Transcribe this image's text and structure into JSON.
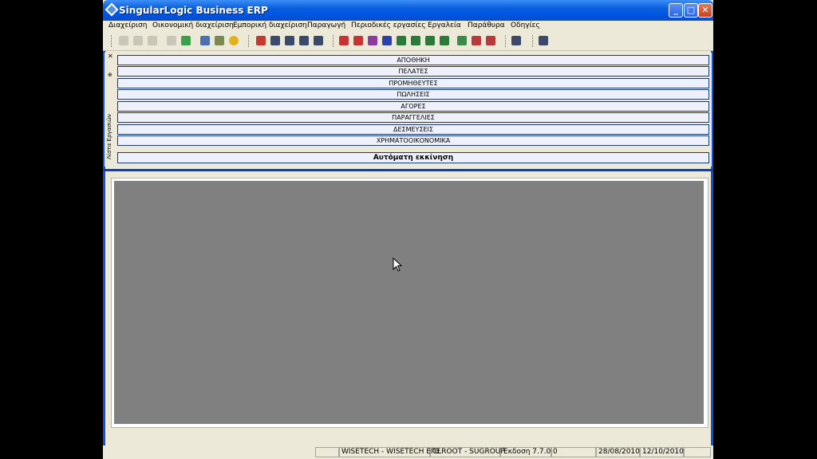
{
  "window": {
    "title": "SingularLogic Business ERP"
  },
  "menu": [
    "Διαχείριση",
    "Οικονομική διαχείριση",
    "Εμπορική διαχείριση",
    "Παραγωγή",
    "Περιοδικές εργασίες",
    "Εργαλεία",
    "Παράθυρα",
    "Οδηγίες"
  ],
  "taskpane": {
    "label": "Λίστα Εργασιών",
    "close": "✕",
    "pin": "⊕",
    "items": [
      "ΑΠΟΘΗΚΗ",
      "ΠΕΛΑΤΕΣ",
      "ΠΡΟΜΗΘΕΥΤΕΣ",
      "ΠΩΛΗΣΕΙΣ",
      "ΑΓΟΡΕΣ",
      "ΠΑΡΑΓΓΕΛΙΕΣ",
      "ΔΕΣΜΕΥΣΕΙΣ",
      "ΧΡΗΜΑΤΟΟΙΚΟΝΟΜΙΚΑ"
    ],
    "auto_start": "Αυτόματη εκκίνηση"
  },
  "statusbar": {
    "company": "WISETECH - WISETECH ΕΠΕ",
    "user": "CLROOT - SUGROUP",
    "version": "Έκδοση 7.7.0.0",
    "date1": "28/08/2010",
    "date2": "12/10/2010"
  },
  "colors": {
    "title_bar": "#0055e5",
    "work_area": "#808080",
    "chrome": "#ece9d8"
  }
}
